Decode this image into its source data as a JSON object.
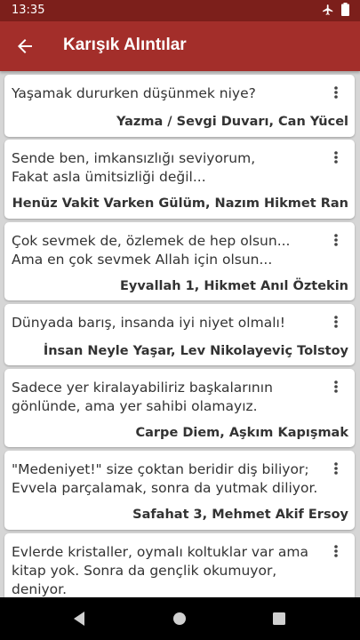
{
  "status": {
    "time": "13:35",
    "icons": [
      "airplane-icon",
      "battery-icon"
    ]
  },
  "appbar": {
    "title": "Karışık Alıntılar",
    "back_icon": "arrow-left-icon"
  },
  "quotes": [
    {
      "text": "Yaşamak dururken düşünmek niye?",
      "source": "Yazma / Sevgi Duvarı, Can Yücel"
    },
    {
      "text": "Sende ben, imkansızlığı seviyorum,\nFakat asla ümitsizliği değil...",
      "source": "Henüz Vakit Varken Gülüm, Nazım Hikmet Ran"
    },
    {
      "text": "Çok sevmek de, özlemek de hep olsun...\nAma en çok sevmek Allah için olsun...",
      "source": "Eyvallah 1, Hikmet Anıl Öztekin"
    },
    {
      "text": "Dünyada barış, insanda iyi niyet olmalı!",
      "source": "İnsan Neyle Yaşar, Lev Nikolayeviç Tolstoy"
    },
    {
      "text": "Sadece yer kiralayabiliriz başkalarının gönlünde, ama yer sahibi olamayız.",
      "source": "Carpe Diem, Aşkım Kapışmak"
    },
    {
      "text": "\"Medeniyet!\" size çoktan beridir diş biliyor;\nEvvela parçalamak, sonra da yutmak diliyor.",
      "source": "Safahat 3, Mehmet Akif Ersoy"
    },
    {
      "text": "Evlerde kristaller, oymalı koltuklar var ama kitap yok. Sonra da gençlik okumuyor, deniyor.",
      "source": ""
    }
  ],
  "navbar": {
    "icons": [
      "back-triangle-icon",
      "home-circle-icon",
      "recents-square-icon"
    ]
  }
}
